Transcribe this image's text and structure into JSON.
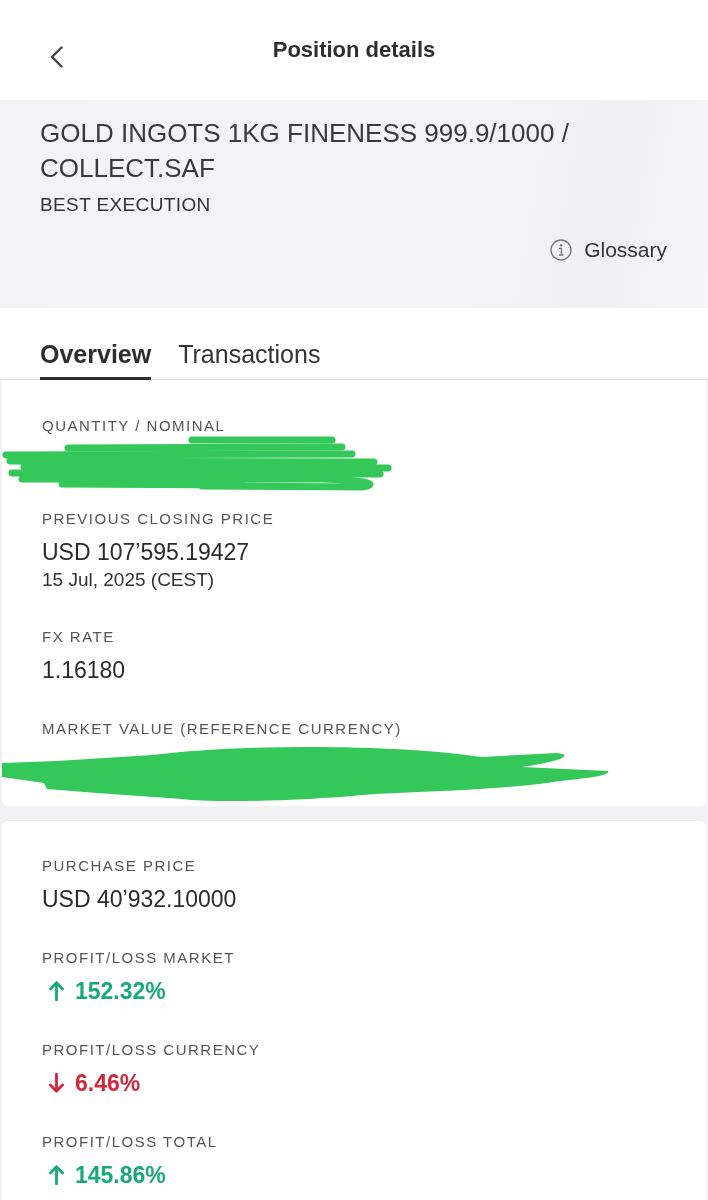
{
  "header": {
    "title": "Position details"
  },
  "instrument": {
    "name": "GOLD INGOTS 1KG FINENESS 999.9/1000 / COLLECT.SAF",
    "subtitle": "BEST EXECUTION",
    "glossary_link": "Glossary"
  },
  "tabs": [
    {
      "label": "Overview",
      "selected": true
    },
    {
      "label": "Transactions",
      "selected": false
    }
  ],
  "cards": [
    {
      "fields": [
        {
          "kind": "redacted",
          "label": "QUANTITY / NOMINAL"
        },
        {
          "kind": "value",
          "label": "PREVIOUS CLOSING PRICE",
          "value": "USD 107’595.19427",
          "note": "15 Jul, 2025 (CEST)"
        },
        {
          "kind": "value",
          "label": "FX RATE",
          "value": "1.16180"
        },
        {
          "kind": "redacted",
          "label": "MARKET VALUE (REFERENCE CURRENCY)"
        }
      ]
    },
    {
      "fields": [
        {
          "kind": "value",
          "label": "PURCHASE PRICE",
          "value": "USD 40’932.10000"
        },
        {
          "kind": "change",
          "label": "PROFIT/LOSS MARKET",
          "value": "152.32%",
          "rising": true
        },
        {
          "kind": "change",
          "label": "PROFIT/LOSS CURRENCY",
          "value": "6.46%",
          "rising": false
        },
        {
          "kind": "change",
          "label": "PROFIT/LOSS TOTAL",
          "value": "145.86%",
          "rising": true
        }
      ]
    }
  ]
}
